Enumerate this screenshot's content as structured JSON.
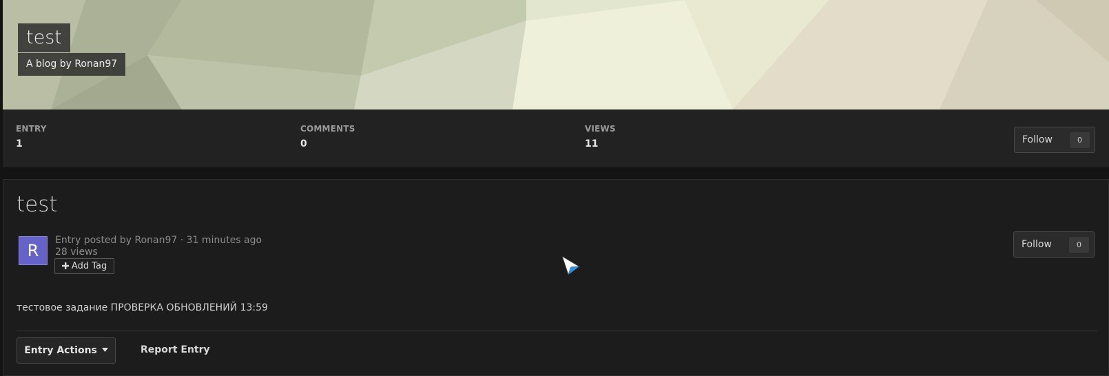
{
  "header": {
    "blog_title": "test",
    "blog_subtitle": "A blog by Ronan97"
  },
  "stats": [
    {
      "label": "ENTRY",
      "value": "1"
    },
    {
      "label": "COMMENTS",
      "value": "0"
    },
    {
      "label": "VIEWS",
      "value": "11"
    }
  ],
  "blog_follow": {
    "label": "Follow",
    "count": "0"
  },
  "entry": {
    "title": "test",
    "avatar_letter": "R",
    "posted_by": "Entry posted by Ronan97 · 31 minutes ago",
    "views": "28 views",
    "add_tag_label": "Add Tag",
    "follow_label": "Follow",
    "follow_count": "0",
    "body": "тестовое задание ПРОВЕРКА ОБНОВЛЕНИЙ 13:59",
    "actions_label": "Entry Actions",
    "report_label": "Report Entry"
  },
  "colors": {
    "avatar": "#6563c9",
    "panel_bg": "#1c1c1c",
    "stats_bg": "#222222",
    "cursor_accent": "#2a8fe0"
  },
  "icons": {
    "add_tag": "plus-icon",
    "entry_actions": "caret-down-icon",
    "pointer": "mouse-cursor-icon"
  }
}
